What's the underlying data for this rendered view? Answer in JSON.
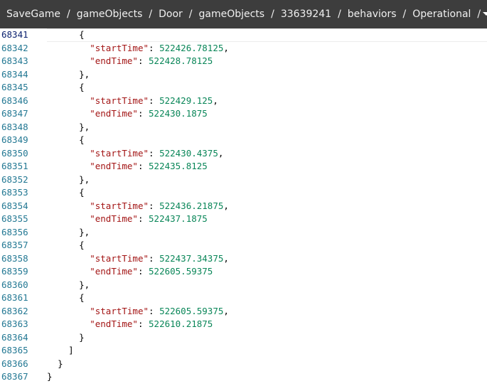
{
  "breadcrumb": {
    "items": [
      "SaveGame",
      "gameObjects",
      "Door",
      "gameObjects",
      "33639241",
      "behaviors",
      "Operational"
    ],
    "separator": "/"
  },
  "colors": {
    "bar_bg": "#3d3d3d",
    "line_number": "#237893",
    "key": "#a31515",
    "number": "#098658"
  },
  "editor": {
    "lines": [
      {
        "num": "68341",
        "indent": 6,
        "text": "{"
      },
      {
        "num": "68342",
        "indent": 8,
        "key": "\"startTime\"",
        "value": "522426.78125",
        "trail": ","
      },
      {
        "num": "68343",
        "indent": 8,
        "key": "\"endTime\"",
        "value": "522428.78125",
        "trail": ""
      },
      {
        "num": "68344",
        "indent": 6,
        "text": "},"
      },
      {
        "num": "68345",
        "indent": 6,
        "text": "{"
      },
      {
        "num": "68346",
        "indent": 8,
        "key": "\"startTime\"",
        "value": "522429.125",
        "trail": ","
      },
      {
        "num": "68347",
        "indent": 8,
        "key": "\"endTime\"",
        "value": "522430.1875",
        "trail": ""
      },
      {
        "num": "68348",
        "indent": 6,
        "text": "},"
      },
      {
        "num": "68349",
        "indent": 6,
        "text": "{"
      },
      {
        "num": "68350",
        "indent": 8,
        "key": "\"startTime\"",
        "value": "522430.4375",
        "trail": ","
      },
      {
        "num": "68351",
        "indent": 8,
        "key": "\"endTime\"",
        "value": "522435.8125",
        "trail": ""
      },
      {
        "num": "68352",
        "indent": 6,
        "text": "},"
      },
      {
        "num": "68353",
        "indent": 6,
        "text": "{"
      },
      {
        "num": "68354",
        "indent": 8,
        "key": "\"startTime\"",
        "value": "522436.21875",
        "trail": ","
      },
      {
        "num": "68355",
        "indent": 8,
        "key": "\"endTime\"",
        "value": "522437.1875",
        "trail": ""
      },
      {
        "num": "68356",
        "indent": 6,
        "text": "},"
      },
      {
        "num": "68357",
        "indent": 6,
        "text": "{"
      },
      {
        "num": "68358",
        "indent": 8,
        "key": "\"startTime\"",
        "value": "522437.34375",
        "trail": ","
      },
      {
        "num": "68359",
        "indent": 8,
        "key": "\"endTime\"",
        "value": "522605.59375",
        "trail": ""
      },
      {
        "num": "68360",
        "indent": 6,
        "text": "},"
      },
      {
        "num": "68361",
        "indent": 6,
        "text": "{"
      },
      {
        "num": "68362",
        "indent": 8,
        "key": "\"startTime\"",
        "value": "522605.59375",
        "trail": ","
      },
      {
        "num": "68363",
        "indent": 8,
        "key": "\"endTime\"",
        "value": "522610.21875",
        "trail": ""
      },
      {
        "num": "68364",
        "indent": 6,
        "text": "}"
      },
      {
        "num": "68365",
        "indent": 4,
        "text": "]"
      },
      {
        "num": "68366",
        "indent": 2,
        "text": "}"
      },
      {
        "num": "68367",
        "indent": 0,
        "text": "}"
      }
    ]
  }
}
